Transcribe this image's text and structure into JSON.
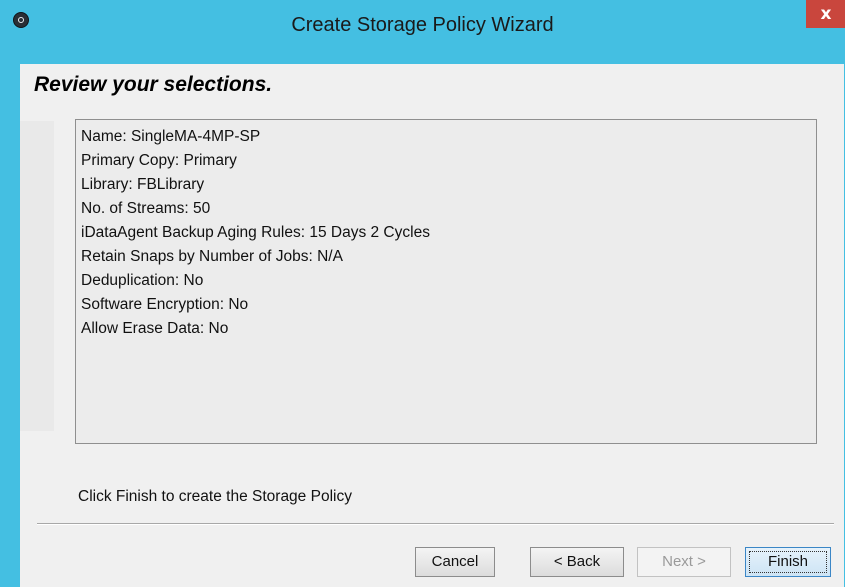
{
  "window": {
    "title": "Create Storage Policy Wizard",
    "close_label": "x"
  },
  "heading": "Review your selections.",
  "summary": [
    "Name: SingleMA-4MP-SP",
    "Primary Copy: Primary",
    "Library: FBLibrary",
    "No. of Streams: 50",
    "iDataAgent Backup Aging Rules: 15 Days 2 Cycles",
    "Retain Snaps by Number of Jobs:  N/A",
    "Deduplication:  No",
    "Software Encryption: No",
    "Allow Erase Data:  No"
  ],
  "footer_text": "Click Finish to create the Storage Policy",
  "buttons": {
    "cancel": "Cancel",
    "back": "< Back",
    "next": "Next >",
    "finish": "Finish"
  },
  "colors": {
    "titlebar": "#44bfe2",
    "close": "#c9463d",
    "dialog_bg": "#f0f0f0"
  }
}
